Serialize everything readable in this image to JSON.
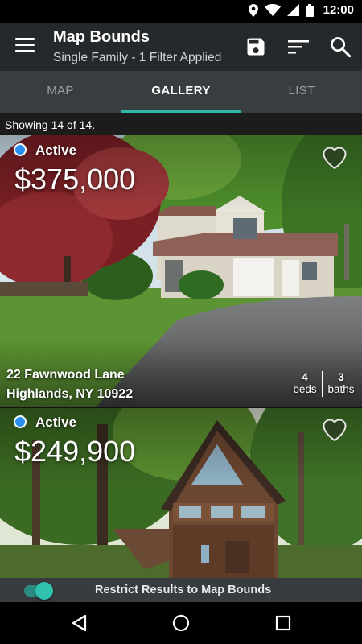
{
  "status_bar": {
    "time": "12:00",
    "icons": [
      "location-icon",
      "wifi-icon",
      "signal-icon",
      "battery-icon"
    ]
  },
  "app_bar": {
    "title": "Map Bounds",
    "subtitle": "Single Family - 1 Filter Applied",
    "icons": [
      "menu-icon",
      "save-icon",
      "sort-icon",
      "search-icon"
    ]
  },
  "tabs": [
    {
      "label": "MAP",
      "active": false
    },
    {
      "label": "GALLERY",
      "active": true
    },
    {
      "label": "LIST",
      "active": false
    }
  ],
  "results": {
    "showing_text": "Showing 14 of 14."
  },
  "listings": [
    {
      "status": "Active",
      "status_color": "#2a8ff0",
      "price": "$375,000",
      "address_line1": "22 Fawnwood Lane",
      "address_line2": "Highlands, NY 10922",
      "beds": "4",
      "beds_label": "beds",
      "baths": "3",
      "baths_label": "baths",
      "favorited": false
    },
    {
      "status": "Active",
      "status_color": "#2a8ff0",
      "price": "$249,900",
      "favorited": false
    }
  ],
  "restrict_bar": {
    "label": "Restrict Results to Map Bounds",
    "toggle_on": true
  },
  "colors": {
    "accent": "#30b8a6",
    "app_bar": "#26292b",
    "tab_bar": "#3a3d3f"
  },
  "nav_bar": {
    "icons": [
      "back-icon",
      "home-icon",
      "recents-icon"
    ]
  }
}
